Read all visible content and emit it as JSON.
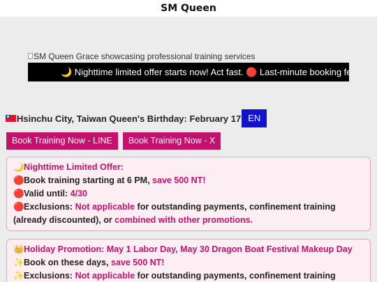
{
  "title": "SM Queen",
  "hero": {
    "image_alt": "SM Queen Grace showcasing professional training services",
    "marquee_text": "🌙 Nighttime limited offer starts now! Act fast. 🔴 Last-minute booking fee redu"
  },
  "info": {
    "flag_icon": "taiwan-flag-icon",
    "location_birthday": "Hsinchu City, Taiwan Queen's Birthday: February 17",
    "language_button": "EN"
  },
  "booking": {
    "line_label": "Book Training Now - LINE",
    "x_label": "Book Training Now - X"
  },
  "colors": {
    "accent": "#c2126e",
    "lang_button": "#1212c9",
    "marquee_bg": "#000000",
    "promo_bg": "#fdeef3",
    "promo_border": "#e6a3bf"
  },
  "promo1": {
    "title_icon": "🌙",
    "title": "Nighttime Limited Offer:",
    "l1_icon": "🔴",
    "l1_text": "Book training starting at 6 PM, ",
    "l1_highlight": "save 500 NT!",
    "l2_icon": "🔴",
    "l2_text": "Valid until: ",
    "l2_highlight": "4/30",
    "l3_icon": "🔴",
    "l3_text_a": "Exclusions: ",
    "l3_highlight_a": "Not applicable",
    "l3_text_b": " for outstanding payments, confinement training (already discounted), or ",
    "l3_highlight_b": "combined with other promotions."
  },
  "promo2": {
    "title_icon": "👑",
    "title": "Holiday Promotion: May 1 Labor Day, May 30 Dragon Boat Festival Makeup Day",
    "l1_icon": "✨",
    "l1_text": "Book on these days, ",
    "l1_highlight": "save 500 NT!",
    "l2_icon": "✨",
    "l2_text_a": "Exclusions: ",
    "l2_highlight_a": "Not applicable",
    "l2_text_b": " for outstanding payments, confinement training"
  }
}
